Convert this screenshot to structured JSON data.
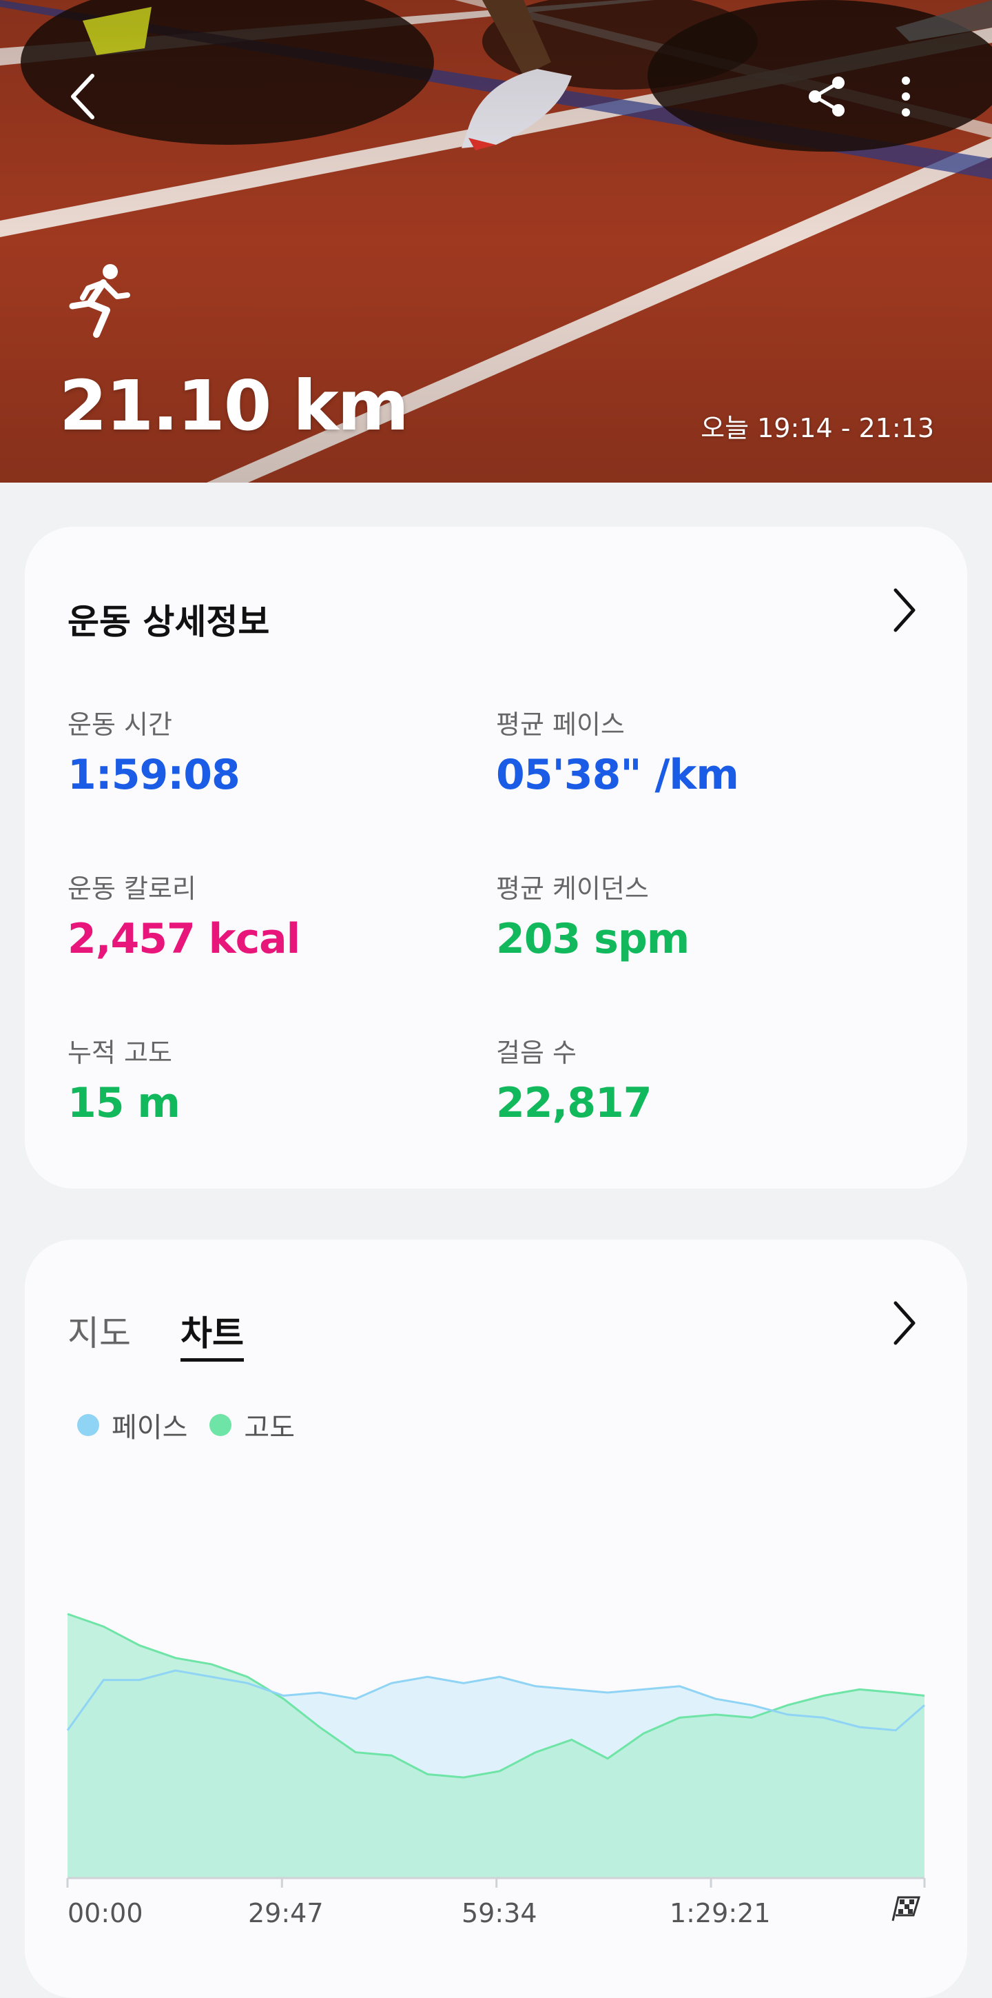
{
  "hero": {
    "distance": "21.10 km",
    "time_range": "오늘 19:14 - 21:13",
    "icons": [
      "back-icon",
      "share-icon",
      "more-vert-icon",
      "running-icon"
    ]
  },
  "details": {
    "title": "운동 상세정보",
    "stats": [
      {
        "label": "운동 시간",
        "value": "1:59:08",
        "color": "#1a5ce6"
      },
      {
        "label": "평균 페이스",
        "value": "05'38\" /km",
        "color": "#1a5ce6"
      },
      {
        "label": "운동 칼로리",
        "value": "2,457 kcal",
        "color": "#e8157b"
      },
      {
        "label": "평균 케이던스",
        "value": "203 spm",
        "color": "#12b85c"
      },
      {
        "label": "누적 고도",
        "value": "15 m",
        "color": "#12b85c"
      },
      {
        "label": "걸음 수",
        "value": "22,817",
        "color": "#12b85c"
      }
    ]
  },
  "chart_card": {
    "tabs": [
      "지도",
      "차트"
    ],
    "active_tab": "차트",
    "legend": [
      {
        "name": "페이스",
        "color": "#8fd3f5"
      },
      {
        "name": "고도",
        "color": "#6ee4a6"
      }
    ],
    "x_ticks": [
      "00:00",
      "29:47",
      "59:34",
      "1:29:21"
    ]
  },
  "chart_data": {
    "type": "area",
    "title": "",
    "xlabel": "",
    "ylabel": "",
    "x": [
      0,
      5,
      10,
      15,
      20,
      25,
      30,
      35,
      40,
      45,
      50,
      55,
      60,
      65,
      70,
      75,
      80,
      85,
      90,
      95,
      100,
      105,
      110,
      115,
      119
    ],
    "series": [
      {
        "name": "페이스",
        "values": [
          0.47,
          0.63,
          0.63,
          0.66,
          0.64,
          0.62,
          0.58,
          0.59,
          0.57,
          0.62,
          0.64,
          0.62,
          0.64,
          0.61,
          0.6,
          0.59,
          0.6,
          0.61,
          0.57,
          0.55,
          0.52,
          0.51,
          0.48,
          0.47,
          0.55
        ]
      },
      {
        "name": "고도",
        "values": [
          0.84,
          0.8,
          0.74,
          0.7,
          0.68,
          0.64,
          0.57,
          0.48,
          0.4,
          0.39,
          0.33,
          0.32,
          0.34,
          0.4,
          0.44,
          0.38,
          0.46,
          0.51,
          0.52,
          0.51,
          0.55,
          0.58,
          0.6,
          0.59,
          0.58
        ]
      }
    ]
  }
}
